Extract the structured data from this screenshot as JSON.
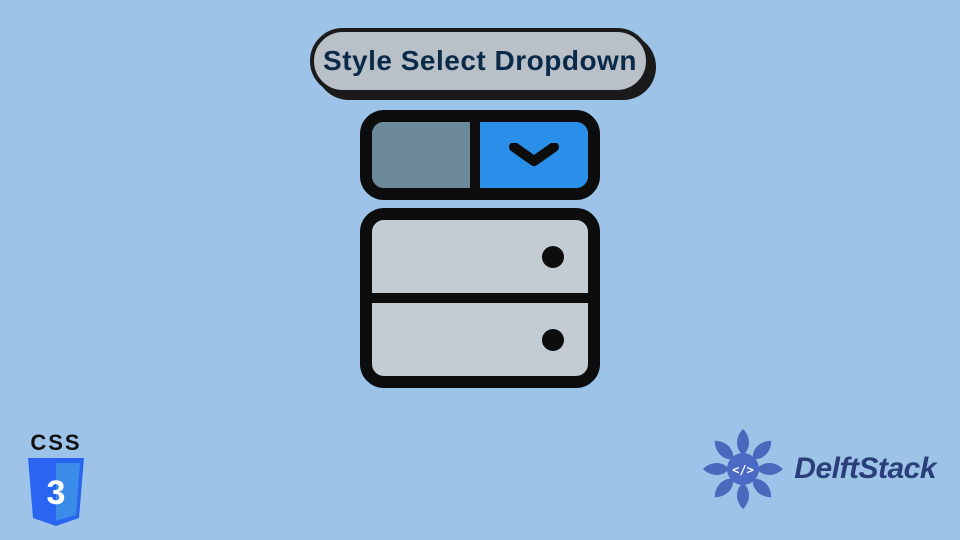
{
  "title": "Style Select Dropdown",
  "badge": {
    "label": "CSS",
    "version": "3"
  },
  "brand": {
    "name": "DelftStack"
  },
  "colors": {
    "background": "#9dc4e8",
    "pill_bg": "#b9c0c7",
    "outline": "#0d0d0d",
    "select_left": "#6d8a9a",
    "select_right": "#2a8fe8",
    "list_bg": "#c3cbd3",
    "css3_shield": "#2965f1",
    "css3_shield_light": "#3b8ce8",
    "brand_text": "#2a3f7a"
  }
}
